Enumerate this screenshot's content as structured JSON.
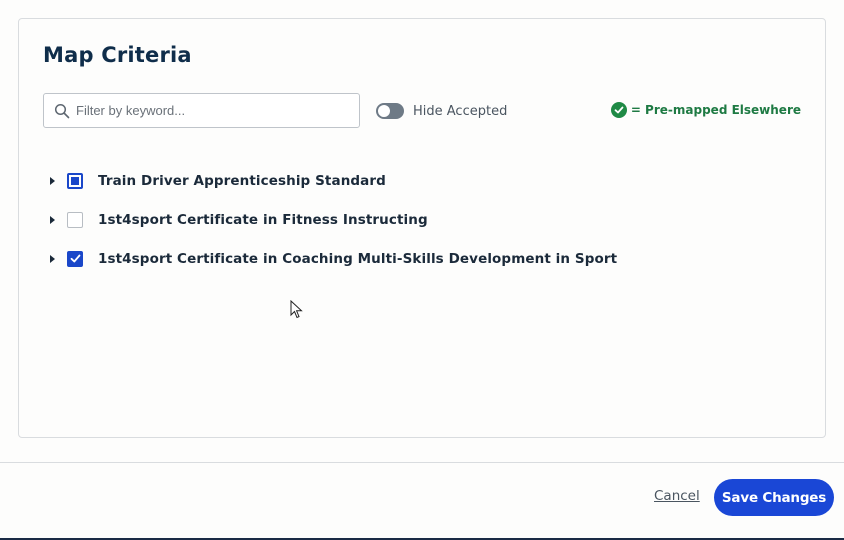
{
  "dialog": {
    "title": "Map Criteria",
    "search": {
      "placeholder": "Filter by keyword..."
    },
    "toggle": {
      "label": "Hide Accepted",
      "on": false
    },
    "legend": {
      "icon": "check-circle-icon",
      "text": "= Pre-mapped Elsewhere",
      "color": "#1f8a45"
    },
    "items": [
      {
        "label": "Train Driver Apprenticeship Standard",
        "state": "partial"
      },
      {
        "label": "1st4sport Certificate in Fitness Instructing",
        "state": "unchecked"
      },
      {
        "label": "1st4sport Certificate in Coaching Multi-Skills Development in Sport",
        "state": "checked"
      }
    ]
  },
  "footer": {
    "cancel_label": "Cancel",
    "save_label": "Save Changes"
  },
  "colors": {
    "accent": "#1a47d6",
    "title": "#0f2d4a",
    "success": "#1f8a45"
  }
}
